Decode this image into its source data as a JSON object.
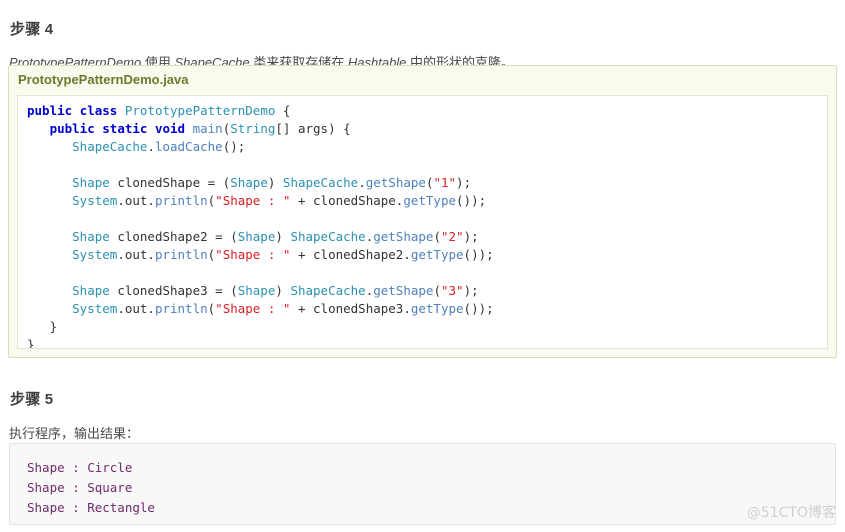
{
  "step4": {
    "heading": "步骤 4",
    "description_parts": [
      {
        "text": "PrototypePatternDemo",
        "italic": true
      },
      {
        "text": " 使用 ",
        "italic": false
      },
      {
        "text": "ShapeCache",
        "italic": true
      },
      {
        "text": " 类来获取存储在 ",
        "italic": false
      },
      {
        "text": "Hashtable",
        "italic": true
      },
      {
        "text": " 中的形状的克隆。",
        "italic": false
      }
    ],
    "description_plain": "PrototypePatternDemo 使用 ShapeCache 类来获取存储在 Hashtable 中的形状的克隆。"
  },
  "code_block": {
    "filename": "PrototypePatternDemo.java",
    "language": "java",
    "lines": [
      [
        {
          "t": "public",
          "c": "kw"
        },
        {
          "t": " ",
          "c": "plain"
        },
        {
          "t": "class",
          "c": "kw"
        },
        {
          "t": " ",
          "c": "plain"
        },
        {
          "t": "PrototypePatternDemo",
          "c": "type"
        },
        {
          "t": " {",
          "c": "punc"
        }
      ],
      [
        {
          "t": "   ",
          "c": "plain"
        },
        {
          "t": "public",
          "c": "kw"
        },
        {
          "t": " ",
          "c": "plain"
        },
        {
          "t": "static",
          "c": "kw"
        },
        {
          "t": " ",
          "c": "plain"
        },
        {
          "t": "void",
          "c": "kw"
        },
        {
          "t": " ",
          "c": "plain"
        },
        {
          "t": "main",
          "c": "meth"
        },
        {
          "t": "(",
          "c": "punc"
        },
        {
          "t": "String",
          "c": "type"
        },
        {
          "t": "[] args) {",
          "c": "punc"
        }
      ],
      [
        {
          "t": "      ",
          "c": "plain"
        },
        {
          "t": "ShapeCache",
          "c": "type"
        },
        {
          "t": ".",
          "c": "punc"
        },
        {
          "t": "loadCache",
          "c": "meth"
        },
        {
          "t": "();",
          "c": "punc"
        }
      ],
      [
        {
          "t": "",
          "c": "plain"
        }
      ],
      [
        {
          "t": "      ",
          "c": "plain"
        },
        {
          "t": "Shape",
          "c": "type"
        },
        {
          "t": " clonedShape = (",
          "c": "punc"
        },
        {
          "t": "Shape",
          "c": "type"
        },
        {
          "t": ") ",
          "c": "punc"
        },
        {
          "t": "ShapeCache",
          "c": "type"
        },
        {
          "t": ".",
          "c": "punc"
        },
        {
          "t": "getShape",
          "c": "meth"
        },
        {
          "t": "(",
          "c": "punc"
        },
        {
          "t": "\"1\"",
          "c": "str"
        },
        {
          "t": ");",
          "c": "punc"
        }
      ],
      [
        {
          "t": "      ",
          "c": "plain"
        },
        {
          "t": "System",
          "c": "type"
        },
        {
          "t": ".out.",
          "c": "punc"
        },
        {
          "t": "println",
          "c": "meth"
        },
        {
          "t": "(",
          "c": "punc"
        },
        {
          "t": "\"Shape : \"",
          "c": "str"
        },
        {
          "t": " + clonedShape.",
          "c": "punc"
        },
        {
          "t": "getType",
          "c": "meth"
        },
        {
          "t": "());",
          "c": "punc"
        }
      ],
      [
        {
          "t": "",
          "c": "plain"
        }
      ],
      [
        {
          "t": "      ",
          "c": "plain"
        },
        {
          "t": "Shape",
          "c": "type"
        },
        {
          "t": " clonedShape2 = (",
          "c": "punc"
        },
        {
          "t": "Shape",
          "c": "type"
        },
        {
          "t": ") ",
          "c": "punc"
        },
        {
          "t": "ShapeCache",
          "c": "type"
        },
        {
          "t": ".",
          "c": "punc"
        },
        {
          "t": "getShape",
          "c": "meth"
        },
        {
          "t": "(",
          "c": "punc"
        },
        {
          "t": "\"2\"",
          "c": "str"
        },
        {
          "t": ");",
          "c": "punc"
        }
      ],
      [
        {
          "t": "      ",
          "c": "plain"
        },
        {
          "t": "System",
          "c": "type"
        },
        {
          "t": ".out.",
          "c": "punc"
        },
        {
          "t": "println",
          "c": "meth"
        },
        {
          "t": "(",
          "c": "punc"
        },
        {
          "t": "\"Shape : \"",
          "c": "str"
        },
        {
          "t": " + clonedShape2.",
          "c": "punc"
        },
        {
          "t": "getType",
          "c": "meth"
        },
        {
          "t": "());",
          "c": "punc"
        }
      ],
      [
        {
          "t": "",
          "c": "plain"
        }
      ],
      [
        {
          "t": "      ",
          "c": "plain"
        },
        {
          "t": "Shape",
          "c": "type"
        },
        {
          "t": " clonedShape3 = (",
          "c": "punc"
        },
        {
          "t": "Shape",
          "c": "type"
        },
        {
          "t": ") ",
          "c": "punc"
        },
        {
          "t": "ShapeCache",
          "c": "type"
        },
        {
          "t": ".",
          "c": "punc"
        },
        {
          "t": "getShape",
          "c": "meth"
        },
        {
          "t": "(",
          "c": "punc"
        },
        {
          "t": "\"3\"",
          "c": "str"
        },
        {
          "t": ");",
          "c": "punc"
        }
      ],
      [
        {
          "t": "      ",
          "c": "plain"
        },
        {
          "t": "System",
          "c": "type"
        },
        {
          "t": ".out.",
          "c": "punc"
        },
        {
          "t": "println",
          "c": "meth"
        },
        {
          "t": "(",
          "c": "punc"
        },
        {
          "t": "\"Shape : \"",
          "c": "str"
        },
        {
          "t": " + clonedShape3.",
          "c": "punc"
        },
        {
          "t": "getType",
          "c": "meth"
        },
        {
          "t": "());",
          "c": "punc"
        }
      ],
      [
        {
          "t": "   }",
          "c": "punc"
        }
      ],
      [
        {
          "t": "}",
          "c": "punc"
        }
      ]
    ],
    "plain_text": "public class PrototypePatternDemo {\n   public static void main(String[] args) {\n      ShapeCache.loadCache();\n\n      Shape clonedShape = (Shape) ShapeCache.getShape(\"1\");\n      System.out.println(\"Shape : \" + clonedShape.getType());\n\n      Shape clonedShape2 = (Shape) ShapeCache.getShape(\"2\");\n      System.out.println(\"Shape : \" + clonedShape2.getType());\n\n      Shape clonedShape3 = (Shape) ShapeCache.getShape(\"3\");\n      System.out.println(\"Shape : \" + clonedShape3.getType());\n   }\n}"
  },
  "step5": {
    "heading": "步骤 5",
    "description": "执行程序，输出结果："
  },
  "output_block": {
    "lines": [
      "Shape : Circle",
      "Shape : Square",
      "Shape : Rectangle"
    ],
    "text": "Shape : Circle\nShape : Square\nShape : Rectangle"
  },
  "watermark": {
    "text": "@51CTO博客"
  },
  "colors": {
    "keyword": "#0000d0",
    "method": "#4f81bd",
    "type": "#2b91af",
    "string": "#d72027",
    "code_title": "#6a7a2e",
    "code_container_bg": "#f9fbef",
    "code_container_border": "#d8dfc0",
    "output_bg": "#f8f8f8",
    "output_text": "#6d2b6d",
    "watermark": "#cfcfcf",
    "body_text": "#4a4a4a"
  }
}
